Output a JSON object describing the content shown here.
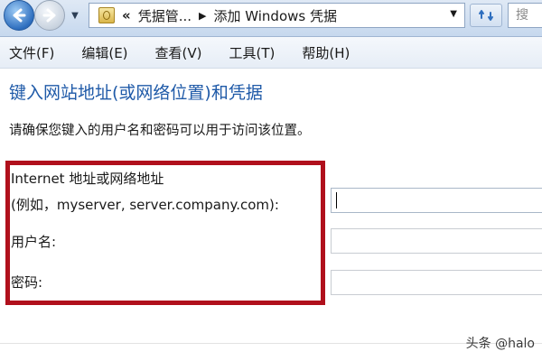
{
  "toolbar": {
    "breadcrumb_chevron": "«",
    "breadcrumb_parent": "凭据管...",
    "breadcrumb_separator": "▶",
    "breadcrumb_current": "添加 Windows 凭据",
    "address_dropdown": "▼",
    "history_dropdown": "▼",
    "search_text": "搜"
  },
  "menu": {
    "items": [
      "文件(F)",
      "编辑(E)",
      "查看(V)",
      "工具(T)",
      "帮助(H)"
    ]
  },
  "form": {
    "heading": "键入网站地址(或网络位置)和凭据",
    "instruction": "请确保您键入的用户名和密码可以用于访问该位置。",
    "address_label_line1": "Internet 地址或网络地址",
    "address_label_line2": "(例如，myserver, server.company.com):",
    "address_value": "",
    "username_label": "用户名:",
    "username_value": "",
    "password_label": "密码:",
    "password_value": ""
  },
  "watermark": "头条 @halo",
  "colors": {
    "heading": "#1f5aa8",
    "highlight_border": "#b0101c",
    "back_button": "#2f6fbf"
  },
  "icons": {
    "back": "back-arrow-icon",
    "forward": "forward-arrow-icon",
    "address": "credential-manager-icon",
    "refresh": "refresh-icon"
  }
}
